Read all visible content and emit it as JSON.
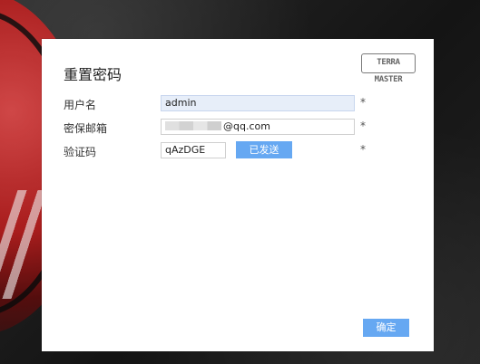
{
  "dialog": {
    "title": "重置密码",
    "brand_logo_text": "TERRA MASTER"
  },
  "form": {
    "username": {
      "label": "用户名",
      "value": "admin",
      "required_mark": "*"
    },
    "email": {
      "label": "密保邮箱",
      "value_suffix": "@qq.com",
      "required_mark": "*"
    },
    "verification_code": {
      "label": "验证码",
      "value": "qAzDGE",
      "send_button_label": "已发送",
      "required_mark": "*"
    }
  },
  "footer": {
    "confirm_label": "确定"
  },
  "colors": {
    "accent_button": "#66a8f2",
    "dialog_background": "#ffffff"
  }
}
